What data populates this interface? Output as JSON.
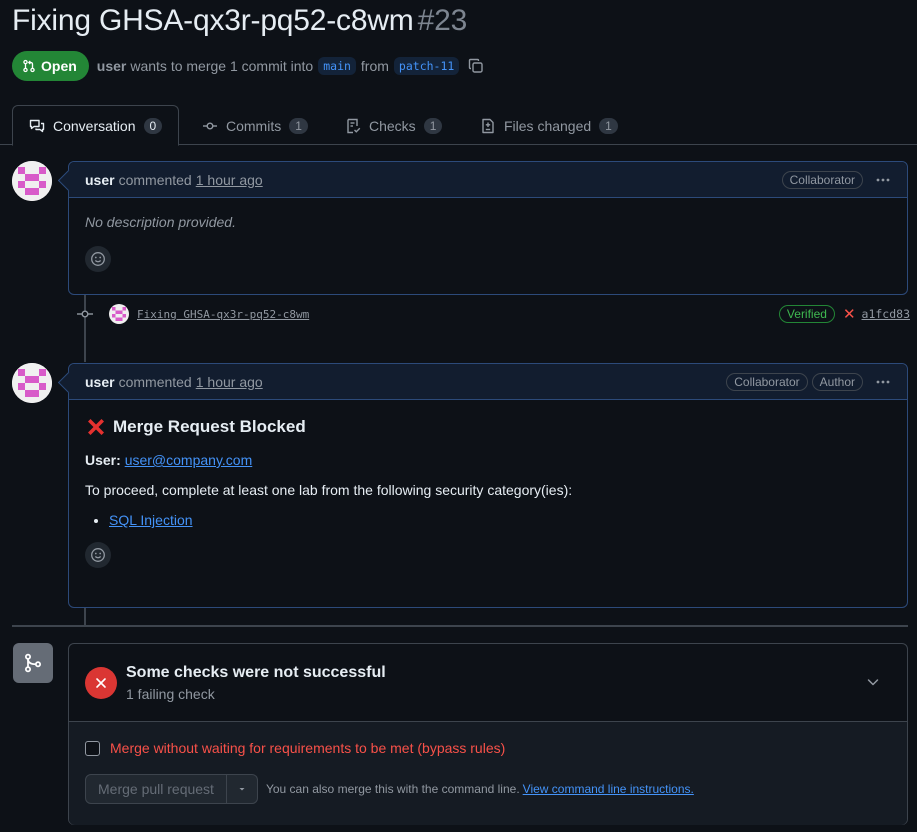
{
  "pr": {
    "title": "Fixing GHSA-qx3r-pq52-c8wm",
    "number": "#23",
    "state": "Open",
    "author": "user",
    "merge_text": "wants to merge 1 commit into",
    "base_branch": "main",
    "from_text": "from",
    "head_branch": "patch-11"
  },
  "tabs": [
    {
      "label": "Conversation",
      "count": "0",
      "icon": "comment-discussion-icon"
    },
    {
      "label": "Commits",
      "count": "1",
      "icon": "git-commit-icon"
    },
    {
      "label": "Checks",
      "count": "1",
      "icon": "checklist-icon"
    },
    {
      "label": "Files changed",
      "count": "1",
      "icon": "file-diff-icon"
    }
  ],
  "comment1": {
    "author": "user",
    "verb": "commented",
    "time": "1 hour ago",
    "labels": [
      "Collaborator"
    ],
    "body": "No description provided."
  },
  "commit": {
    "message": "Fixing GHSA-qx3r-pq52-c8wm",
    "verified": "Verified",
    "status": "✕",
    "sha": "a1fcd83"
  },
  "comment2": {
    "author": "user",
    "verb": "commented",
    "time": "1 hour ago",
    "labels": [
      "Collaborator",
      "Author"
    ],
    "heading": "Merge Request Blocked",
    "user_label": "User:",
    "user_email": "user@company.com",
    "instruction": "To proceed, complete at least one lab from the following security category(ies):",
    "categories": [
      "SQL Injection"
    ]
  },
  "merge": {
    "status_title": "Some checks were not successful",
    "status_sub": "1 failing check",
    "bypass_label": "Merge without waiting for requirements to be met (bypass rules)",
    "merge_button": "Merge pull request",
    "cli_text": "You can also merge this with the command line.",
    "cli_link": "View command line instructions."
  },
  "colors": {
    "open_green": "#238636",
    "accent_blue": "#4493f8",
    "danger_red": "#da3633"
  }
}
